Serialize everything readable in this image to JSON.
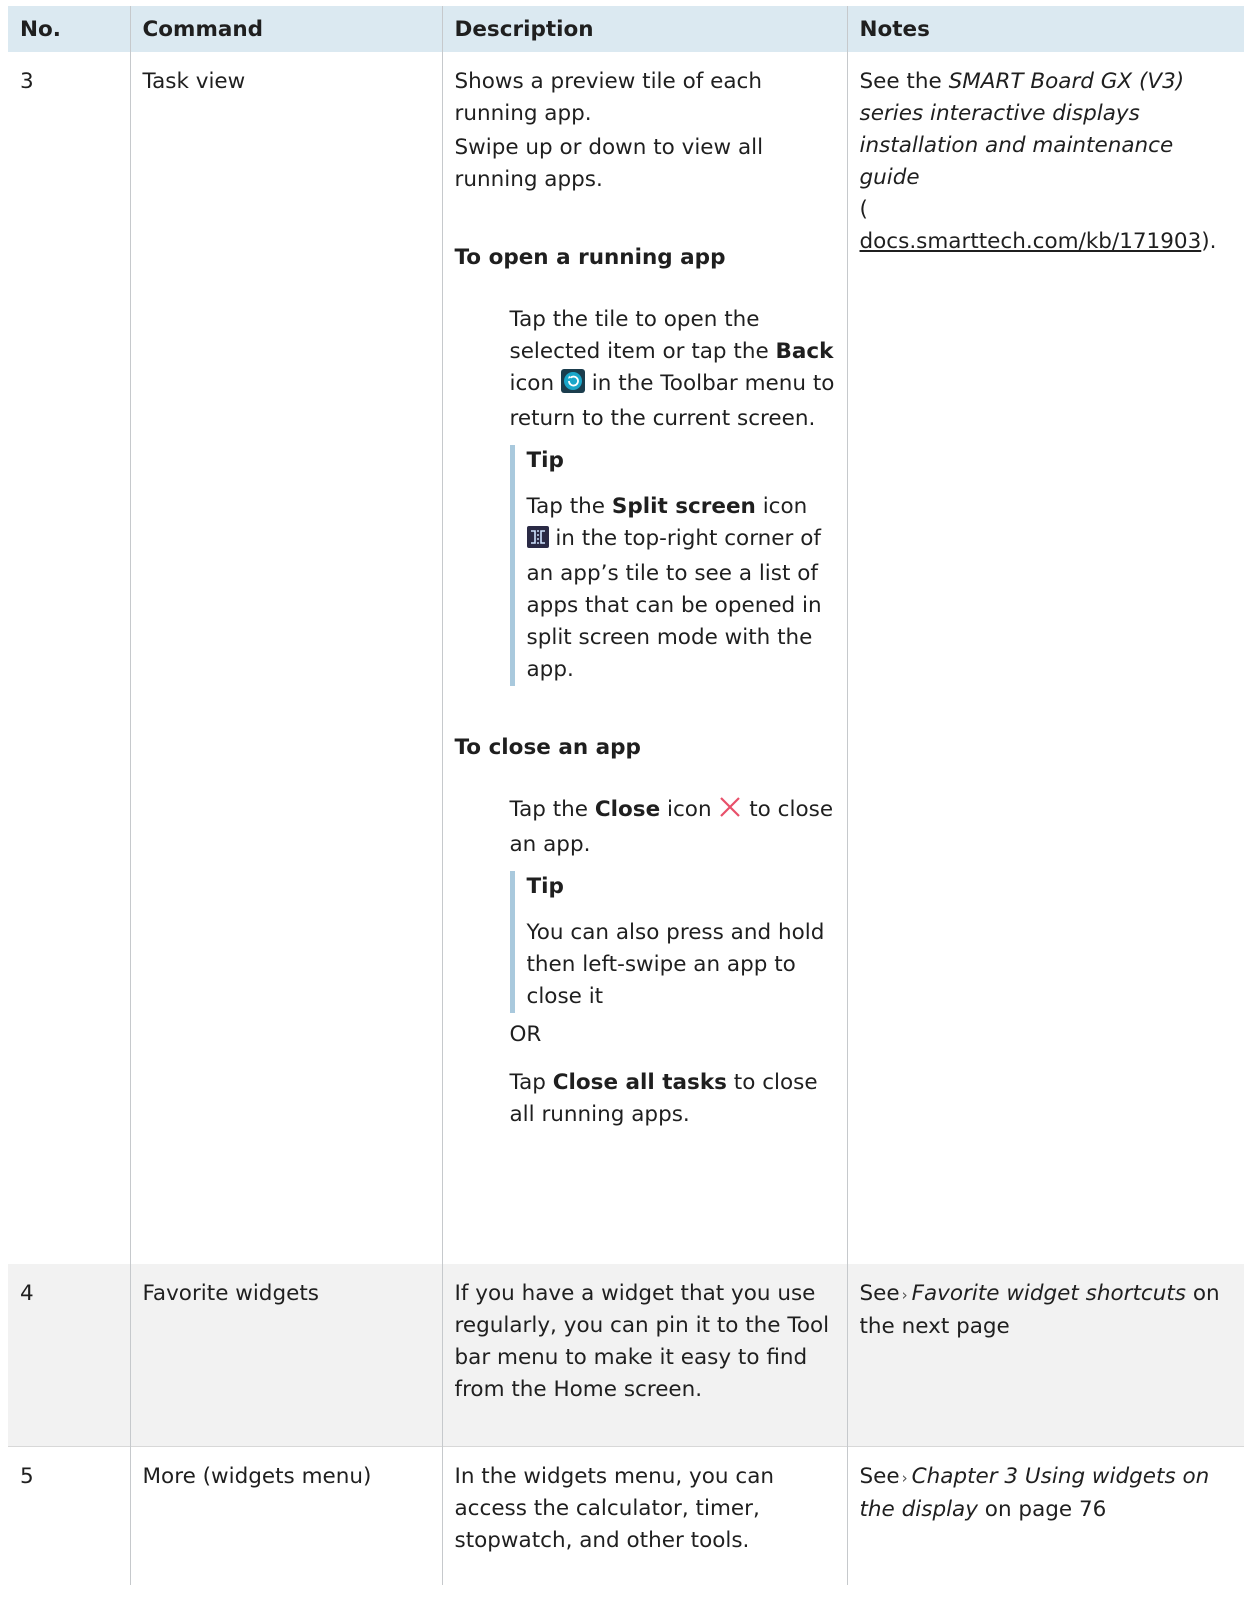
{
  "headers": [
    "No.",
    "Command",
    "Description",
    "Notes"
  ],
  "row3": {
    "no": "3",
    "command": "Task view",
    "desc_p1": "Shows a preview tile of each running app.",
    "desc_p2": "Swipe up or down to view all running apps.",
    "open_heading": "To open a running app",
    "open_step_a": "Tap the tile to open the selected item or tap the ",
    "open_step_b": "Back",
    "open_step_c": " icon ",
    "open_step_d": " in the Toolbar menu to return to the current screen.",
    "tip1_title": "Tip",
    "tip1_a": "Tap the ",
    "tip1_b": "Split screen",
    "tip1_c": " icon ",
    "tip1_d": " in the top-right corner of an app’s tile to see a list of apps that can be opened in split screen mode with the app.",
    "close_heading": "To close an app",
    "close_step_a": "Tap the ",
    "close_step_b": "Close",
    "close_step_c": " icon ",
    "close_step_d": " to close an app.",
    "tip2_title": "Tip",
    "tip2_text": "You can also press and hold then left-swipe an app to close it",
    "or_text": "OR",
    "closeall_a": "Tap ",
    "closeall_b": "Close all tasks",
    "closeall_c": " to close all running apps.",
    "notes_a": "See the ",
    "notes_title": "SMART Board GX (V3) series interactive displays installation and maintenance guide",
    "notes_paren_open": "(",
    "notes_link": "docs.smarttech.com/kb/171903",
    "notes_paren_close": ")."
  },
  "row4": {
    "no": "4",
    "command": "Favorite widgets",
    "description": "If you have a widget that you use regularly, you can pin it to the Tool bar menu to make it easy to find from the Home screen.",
    "notes_see": "See",
    "notes_link": "Favorite widget shortcuts",
    "notes_after": " on the next page"
  },
  "row5": {
    "no": "5",
    "command": "More (widgets menu)",
    "description": "In the widgets menu, you can access the calculator, timer, stopwatch, and other tools.",
    "notes_see": "See",
    "notes_link": "Chapter 3 Using widgets on the display",
    "notes_after": " on page 76"
  },
  "icons": {
    "back": "back-icon",
    "split": "split-screen-icon",
    "close": "close-icon",
    "arrow": "chevron-right-icon"
  },
  "colors": {
    "header_bg": "#dbe9f1",
    "tip_bar": "#a9c9dd",
    "close_icon": "#e8506a",
    "back_icon": "#1aa6c9"
  }
}
